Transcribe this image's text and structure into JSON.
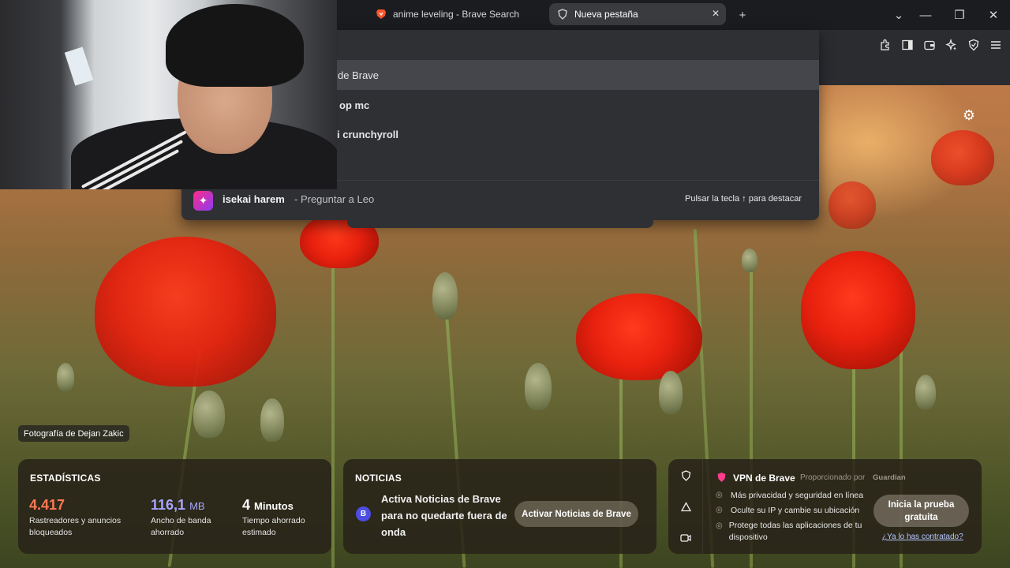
{
  "tabs": [
    {
      "title": "anime leveling - Brave Search",
      "icon": "brave-lion-icon"
    },
    {
      "title": "Nueva pestaña",
      "icon": "brave-shield-icon"
    }
  ],
  "window_controls": {
    "new_tab": "+",
    "tab_list": "⌄",
    "minimize": "—",
    "restore": "❐",
    "close": "✕"
  },
  "omnibox": {
    "suggestions": [
      "de Brave",
      "op mc",
      "i crunchyroll"
    ],
    "leo": {
      "query": "isekai harem",
      "action": "- Preguntar a Leo",
      "hint": "Pulsar la tecla ↑ para destacar"
    }
  },
  "background": {
    "credit": "Fotografía de Dejan Zakic"
  },
  "stats": {
    "title": "ESTADÍSTICAS",
    "trackers_value": "4.417",
    "trackers_label": "Rastreadores y anuncios bloqueados",
    "bandwidth_value": "116,1",
    "bandwidth_unit": "MB",
    "bandwidth_label": "Ancho de banda ahorrado",
    "time_value": "4",
    "time_unit": "Minutos",
    "time_label": "Tiempo ahorrado estimado",
    "colors": {
      "trackers": "#ff7a53",
      "bandwidth": "#a7a6ff",
      "time": "#ffffff"
    }
  },
  "news": {
    "title": "NOTICIAS",
    "text": "Activa Noticias de Brave para no quedarte fuera de onda",
    "button": "Activar Noticias de Brave"
  },
  "vpn": {
    "title": "VPN de Brave",
    "powered_by": "Proporcionado por",
    "partner": "Guardian",
    "features": [
      "Más privacidad y seguridad en línea",
      "Oculte su IP y cambie su ubicación",
      "Protege todas las aplicaciones de tu dispositivo"
    ],
    "trial_button": "Inicia la prueba gratuita",
    "already_link": "¿Ya lo has contratado?"
  }
}
